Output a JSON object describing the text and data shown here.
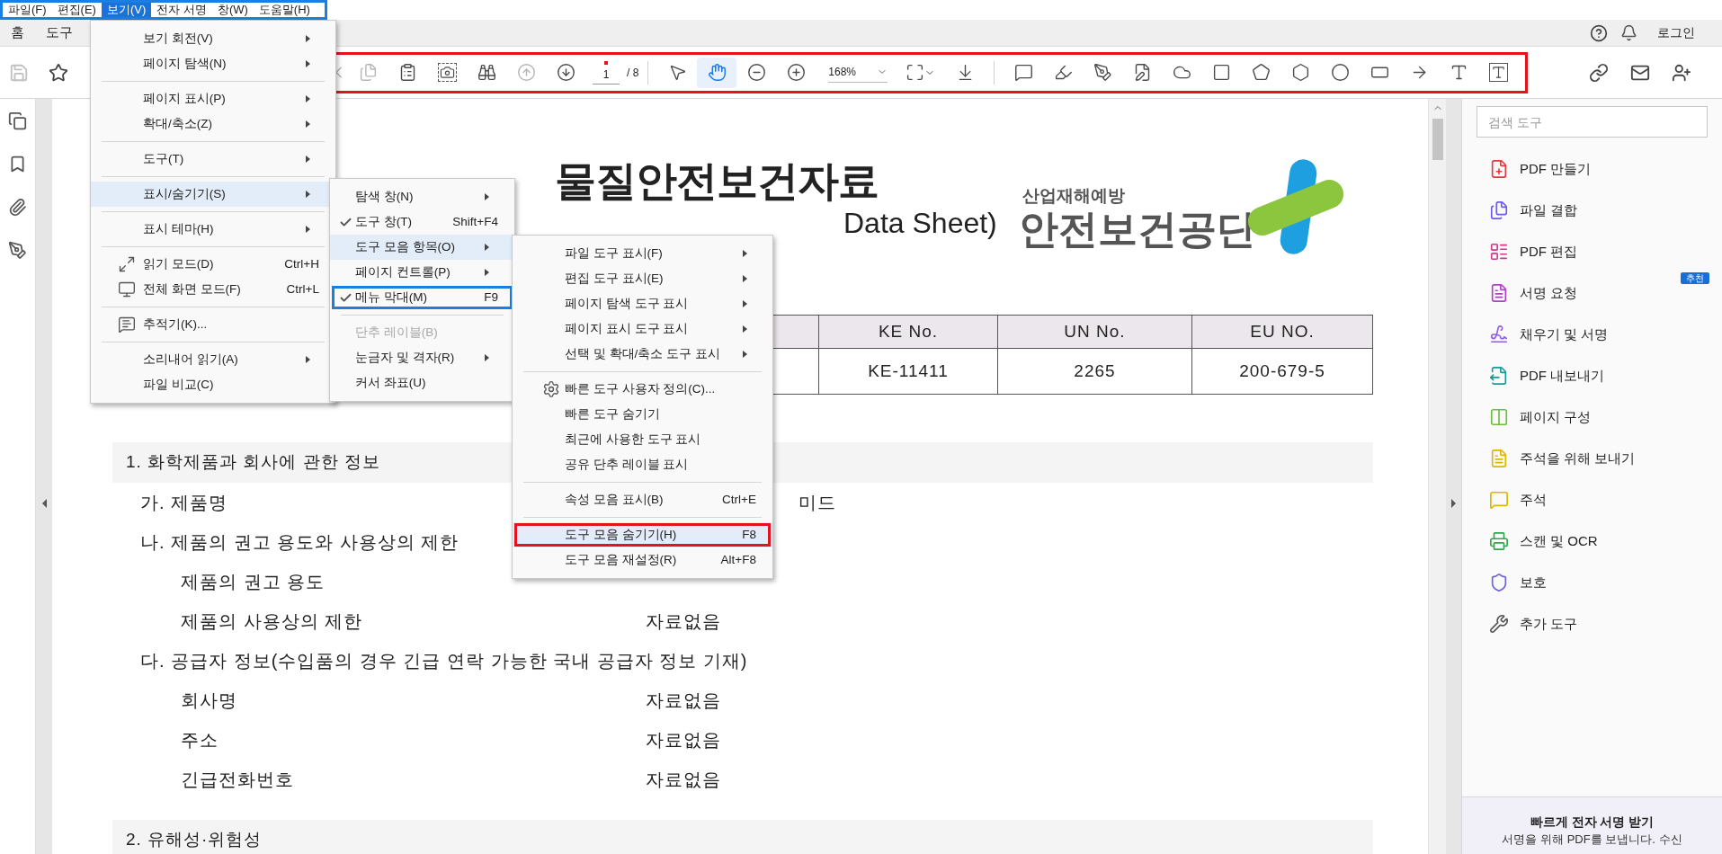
{
  "menu_bar": {
    "color": "#1a7fe0",
    "items": [
      {
        "label": "파일(F)",
        "selected": false
      },
      {
        "label": "편집(E)",
        "selected": false
      },
      {
        "label": "보기(V)",
        "selected": true
      },
      {
        "label": "전자 서명",
        "selected": false
      },
      {
        "label": "창(W)",
        "selected": false
      },
      {
        "label": "도움말(H)",
        "selected": false
      }
    ]
  },
  "tabs": [
    {
      "label": "홈",
      "selected": false
    },
    {
      "label": "도구",
      "selected": false
    }
  ],
  "account": {
    "login": "로그인"
  },
  "toolbar": {
    "color": "#e5131d",
    "page": {
      "current": "1",
      "total": "/ 8"
    },
    "zoom": "168%",
    "tools": [
      {
        "selected": false,
        "disabled": true
      },
      {
        "selected": false,
        "disabled": true
      },
      {
        "selected": false,
        "disabled": false
      },
      {
        "selected": false,
        "disabled": false
      },
      {
        "selected": false,
        "disabled": false
      },
      {
        "selected": false,
        "disabled": true
      },
      {
        "selected": false,
        "disabled": false
      },
      {
        "selected": false,
        "disabled": false
      },
      {
        "selected": true,
        "disabled": false
      },
      {
        "selected": false,
        "disabled": false
      },
      {
        "selected": false,
        "disabled": false
      },
      {
        "selected": false,
        "disabled": false
      },
      {
        "selected": false,
        "disabled": false
      },
      {
        "selected": false,
        "disabled": false
      },
      {
        "selected": false,
        "disabled": false
      },
      {
        "selected": false,
        "disabled": false
      },
      {
        "selected": false,
        "disabled": false
      },
      {
        "selected": false,
        "disabled": false
      },
      {
        "selected": false,
        "disabled": false
      },
      {
        "selected": false,
        "disabled": false
      },
      {
        "selected": false,
        "disabled": false
      },
      {
        "selected": false,
        "disabled": false
      },
      {
        "selected": false,
        "disabled": false
      },
      {
        "selected": false,
        "disabled": false
      },
      {
        "selected": false,
        "disabled": false
      },
      {
        "selected": false,
        "disabled": false
      }
    ]
  },
  "view_menu": [
    {
      "kind": "item",
      "label": "보기 회전(V)",
      "submenu": true,
      "selected": false
    },
    {
      "kind": "item",
      "label": "페이지 탐색(N)",
      "submenu": true,
      "selected": false
    },
    {
      "kind": "separator"
    },
    {
      "kind": "item",
      "label": "페이지 표시(P)",
      "submenu": true,
      "selected": false
    },
    {
      "kind": "item",
      "label": "확대/축소(Z)",
      "submenu": true,
      "selected": false
    },
    {
      "kind": "separator"
    },
    {
      "kind": "item",
      "label": "도구(T)",
      "submenu": true,
      "selected": false
    },
    {
      "kind": "separator"
    },
    {
      "kind": "item",
      "label": "표시/숨기기(S)",
      "submenu": true,
      "selected": true
    },
    {
      "kind": "separator"
    },
    {
      "kind": "item",
      "label": "표시 테마(H)",
      "submenu": true,
      "selected": false
    },
    {
      "kind": "separator"
    },
    {
      "kind": "item",
      "label": "읽기 모드(D)",
      "shortcut": "Ctrl+H",
      "submenu": false,
      "selected": false
    },
    {
      "kind": "item",
      "label": "전체 화면 모드(F)",
      "shortcut": "Ctrl+L",
      "submenu": false,
      "selected": false
    },
    {
      "kind": "separator"
    },
    {
      "kind": "item",
      "label": "추적기(K)...",
      "submenu": false,
      "selected": false
    },
    {
      "kind": "separator"
    },
    {
      "kind": "item",
      "label": "소리내어 읽기(A)",
      "submenu": true,
      "selected": false
    },
    {
      "kind": "item",
      "label": "파일 비교(C)",
      "submenu": false,
      "selected": false
    }
  ],
  "show_hide_menu": [
    {
      "kind": "item",
      "label": "탐색 창(N)",
      "submenu": true,
      "selected": false,
      "checked": false,
      "disabled": false
    },
    {
      "kind": "item",
      "label": "도구 창(T)",
      "shortcut": "Shift+F4",
      "submenu": false,
      "selected": false,
      "checked": true,
      "disabled": false
    },
    {
      "kind": "item",
      "label": "도구 모음 항목(O)",
      "submenu": true,
      "selected": true,
      "checked": false,
      "disabled": false
    },
    {
      "kind": "item",
      "label": "페이지 컨트롤(P)",
      "submenu": true,
      "selected": false,
      "checked": false,
      "disabled": false
    },
    {
      "kind": "item",
      "label": "메뉴 막대(M)",
      "shortcut": "F9",
      "submenu": false,
      "selected": false,
      "checked": true,
      "disabled": false,
      "color": "#1a7fe0"
    },
    {
      "kind": "separator"
    },
    {
      "kind": "item",
      "label": "단추 레이블(B)",
      "submenu": false,
      "selected": false,
      "checked": false,
      "disabled": true
    },
    {
      "kind": "item",
      "label": "눈금자 및 격자(R)",
      "submenu": true,
      "selected": false,
      "checked": false,
      "disabled": false
    },
    {
      "kind": "item",
      "label": "커서 좌표(U)",
      "submenu": false,
      "selected": false,
      "checked": false,
      "disabled": false
    }
  ],
  "toolbar_items_menu": [
    {
      "kind": "item",
      "label": "파일 도구 표시(F)",
      "submenu": true,
      "selected": false
    },
    {
      "kind": "item",
      "label": "편집 도구 표시(E)",
      "submenu": true,
      "selected": false
    },
    {
      "kind": "item",
      "label": "페이지 탐색 도구 표시",
      "submenu": true,
      "selected": false
    },
    {
      "kind": "item",
      "label": "페이지 표시 도구 표시",
      "submenu": true,
      "selected": false
    },
    {
      "kind": "item",
      "label": "선택 및 확대/축소 도구 표시",
      "submenu": true,
      "selected": false
    },
    {
      "kind": "separator"
    },
    {
      "kind": "item",
      "label": "빠른 도구 사용자 정의(C)...",
      "submenu": false,
      "selected": false
    },
    {
      "kind": "item",
      "label": "빠른 도구 숨기기",
      "submenu": false,
      "selected": false
    },
    {
      "kind": "item",
      "label": "최근에 사용한 도구 표시",
      "submenu": false,
      "selected": false
    },
    {
      "kind": "item",
      "label": "공유 단추 레이블 표시",
      "submenu": false,
      "selected": false
    },
    {
      "kind": "separator"
    },
    {
      "kind": "item",
      "label": "속성 모음 표시(B)",
      "shortcut": "Ctrl+E",
      "submenu": false,
      "selected": false
    },
    {
      "kind": "separator"
    },
    {
      "kind": "item",
      "label": "도구 모음 숨기기(H)",
      "shortcut": "F8",
      "submenu": false,
      "selected": true,
      "color": "#e5131d"
    },
    {
      "kind": "item",
      "label": "도구 모음 재설정(R)",
      "shortcut": "Alt+F8",
      "submenu": false,
      "selected": false
    }
  ],
  "document": {
    "title": "물질안전보건자료",
    "subtitle": "Data Sheet)",
    "logo": {
      "subtitle": "산업재해예방",
      "name": "안전보건공단"
    },
    "table": {
      "columns": [
        "KE No.",
        "UN No.",
        "EU NO."
      ],
      "row": [
        "KE-11411",
        "2265",
        "200-679-5"
      ]
    },
    "sections": [
      {
        "heading": "1. 화학제품과 회사에 관한 정보",
        "lines": [
          {
            "kind": "item",
            "label": "가. 제품명",
            "value": "미드"
          },
          {
            "kind": "item",
            "label": "나. 제품의 권고 용도와 사용상의 제한"
          },
          {
            "kind": "field",
            "label": "제품의 권고 용도"
          },
          {
            "kind": "field",
            "label": "제품의 사용상의 제한",
            "value": "자료없음"
          },
          {
            "kind": "item",
            "label": "다. 공급자 정보(수입품의 경우 긴급 연락 가능한 국내 공급자 정보 기재)"
          },
          {
            "kind": "field",
            "label": "회사명",
            "value": "자료없음"
          },
          {
            "kind": "field",
            "label": "주소",
            "value": "자료없음"
          },
          {
            "kind": "field",
            "label": "긴급전화번호",
            "value": "자료없음"
          }
        ]
      },
      {
        "heading": "2. 유해성·위험성"
      }
    ]
  },
  "tools_panel": {
    "search": {
      "placeholder": "검색 도구"
    },
    "items": [
      {
        "label": "PDF 만들기"
      },
      {
        "label": "파일 결합"
      },
      {
        "label": "PDF 편집"
      },
      {
        "label": "서명 요청",
        "badge": "추천"
      },
      {
        "label": "채우기 및 서명"
      },
      {
        "label": "PDF 내보내기"
      },
      {
        "label": "페이지 구성"
      },
      {
        "label": "주석을 위해 보내기"
      },
      {
        "label": "주석"
      },
      {
        "label": "스캔 및 OCR"
      },
      {
        "label": "보호"
      },
      {
        "label": "추가 도구"
      }
    ],
    "promo": {
      "title": "빠르게 전자 서명 받기",
      "text": "서명을 위해 PDF를 보냅니다. 수신"
    }
  }
}
